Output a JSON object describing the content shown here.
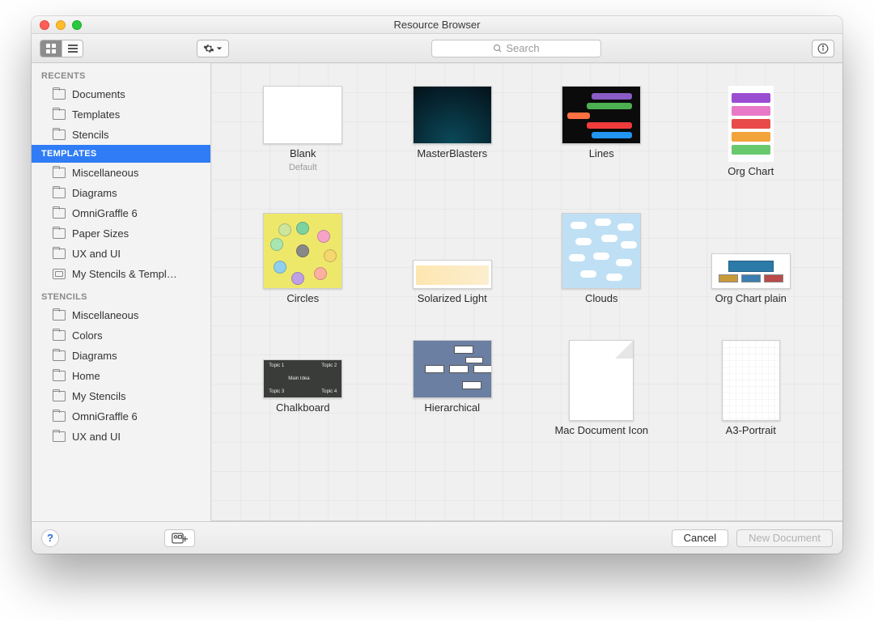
{
  "window": {
    "title": "Resource Browser"
  },
  "toolbar": {
    "search_placeholder": "Search"
  },
  "sidebar": {
    "sections": [
      {
        "title": "RECENTS",
        "selected": false,
        "items": [
          "Documents",
          "Templates",
          "Stencils"
        ]
      },
      {
        "title": "TEMPLATES",
        "selected": true,
        "items": [
          "Miscellaneous",
          "Diagrams",
          "OmniGraffle 6",
          "Paper Sizes",
          "UX and UI",
          "My Stencils & Templ…"
        ]
      },
      {
        "title": "STENCILS",
        "selected": false,
        "items": [
          "Miscellaneous",
          "Colors",
          "Diagrams",
          "Home",
          "My Stencils",
          "OmniGraffle 6",
          "UX and UI"
        ]
      }
    ]
  },
  "templates": [
    {
      "label": "Blank",
      "sub": "Default",
      "kind": "blank"
    },
    {
      "label": "MasterBlasters",
      "kind": "master"
    },
    {
      "label": "Lines",
      "kind": "lines"
    },
    {
      "label": "Org Chart",
      "kind": "org"
    },
    {
      "label": "Circles",
      "kind": "circles"
    },
    {
      "label": "Solarized Light",
      "kind": "sol"
    },
    {
      "label": "Clouds",
      "kind": "clouds"
    },
    {
      "label": "Org Chart plain",
      "kind": "orgp"
    },
    {
      "label": "Chalkboard",
      "kind": "chalk"
    },
    {
      "label": "Hierarchical",
      "kind": "hier"
    },
    {
      "label": "Mac Document Icon",
      "kind": "doc"
    },
    {
      "label": "A3-Portrait",
      "kind": "a3"
    }
  ],
  "footer": {
    "cancel": "Cancel",
    "new_document": "New Document"
  }
}
